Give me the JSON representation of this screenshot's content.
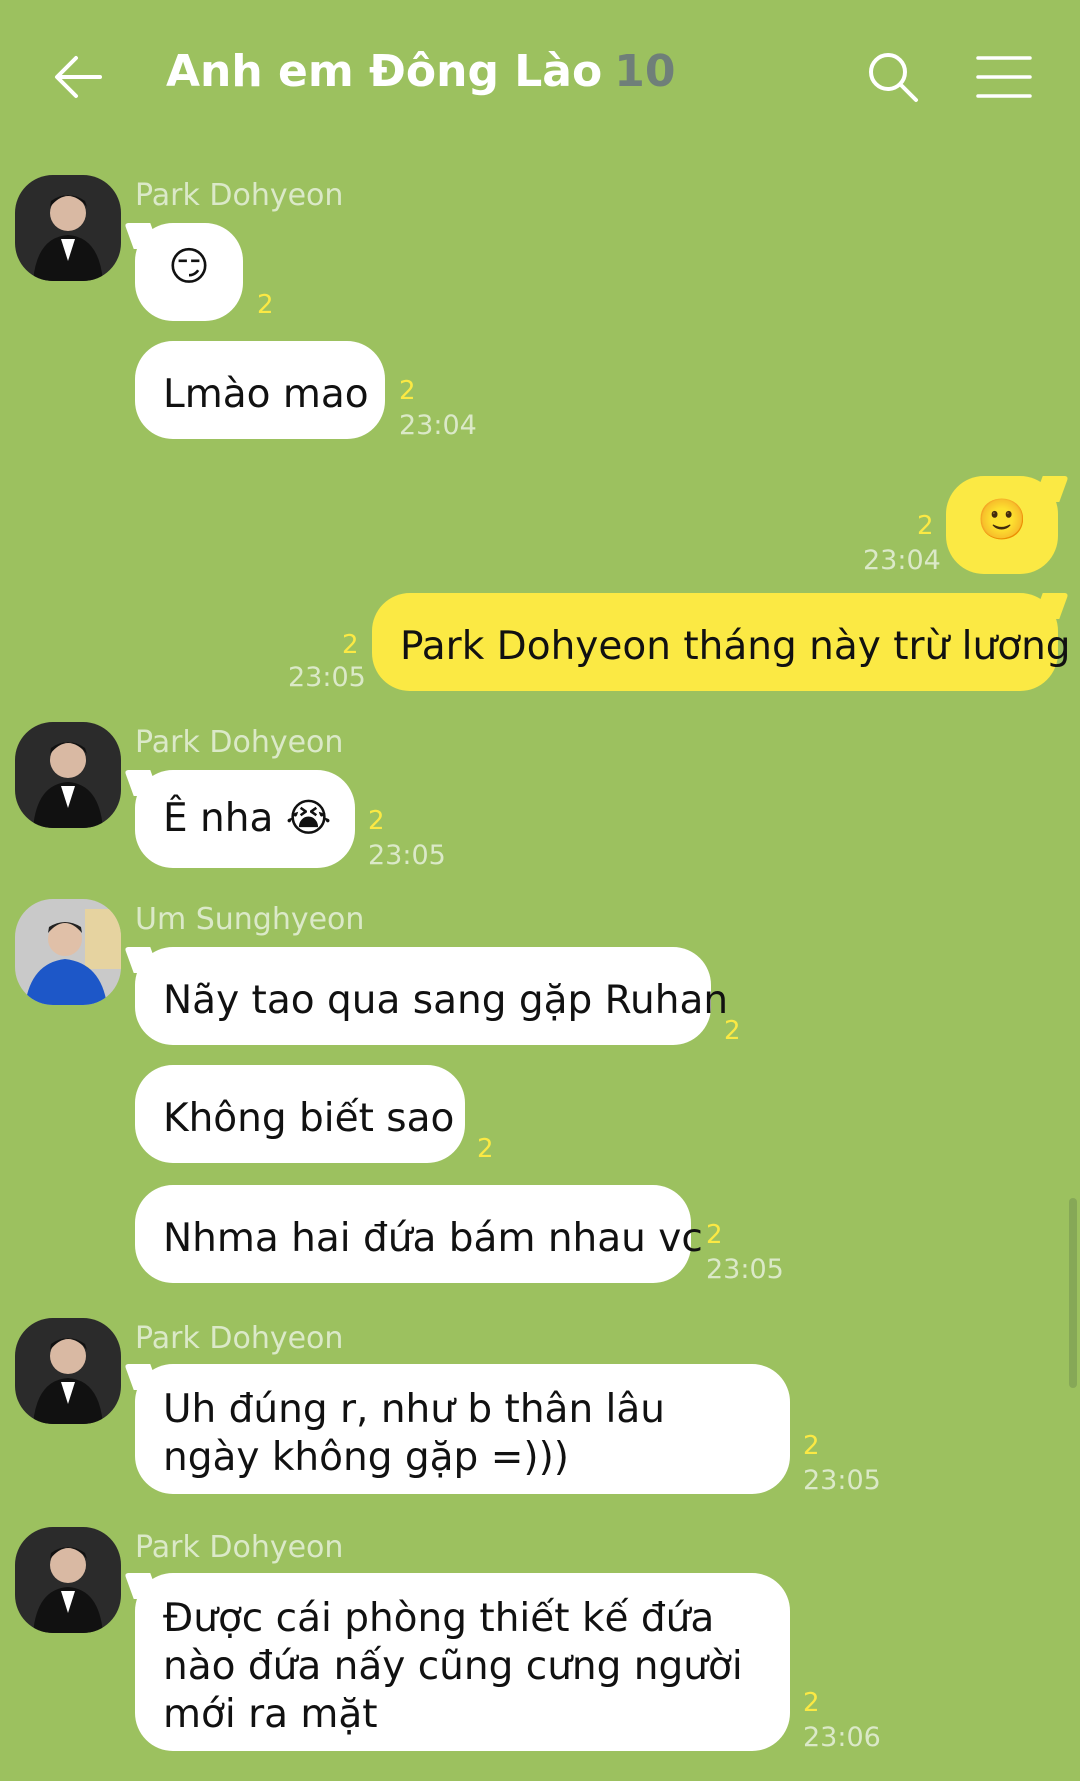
{
  "header": {
    "title": "Anh em Đông Lào",
    "member_count": "10",
    "back_icon": "arrow-left-icon",
    "search_icon": "search-icon",
    "menu_icon": "hamburger-menu-icon"
  },
  "colors": {
    "background": "#9cc15f",
    "my_bubble": "#fbe944",
    "other_bubble": "#ffffff",
    "unread": "#fbe944"
  },
  "messages": [
    {
      "sender": "Park Dohyeon",
      "text": "😏",
      "unread": "2",
      "time": ""
    },
    {
      "sender": "",
      "text": "Lmào mao",
      "unread": "2",
      "time": "23:04"
    },
    {
      "sender": "me",
      "text": "🙂",
      "unread": "2",
      "time": "23:04"
    },
    {
      "sender": "me",
      "text": "Park Dohyeon tháng này trừ lương",
      "unread": "2",
      "time": "23:05"
    },
    {
      "sender": "Park Dohyeon",
      "text": "Ê nha 😭",
      "unread": "2",
      "time": "23:05"
    },
    {
      "sender": "Um Sunghyeon",
      "text": "Nãy tao qua sang gặp Ruhan",
      "unread": "2",
      "time": ""
    },
    {
      "sender": "",
      "text": "Không biết sao",
      "unread": "2",
      "time": ""
    },
    {
      "sender": "",
      "text": "Nhma hai đứa bám nhau vc",
      "unread": "2",
      "time": "23:05"
    },
    {
      "sender": "Park Dohyeon",
      "text": "Uh đúng r, như b thân lâu ngày không gặp =)))",
      "unread": "2",
      "time": "23:05"
    },
    {
      "sender": "Park Dohyeon",
      "text": "Được cái phòng thiết kế đứa nào đứa nấy cũng cưng người mới ra mặt",
      "unread": "2",
      "time": "23:06"
    }
  ]
}
